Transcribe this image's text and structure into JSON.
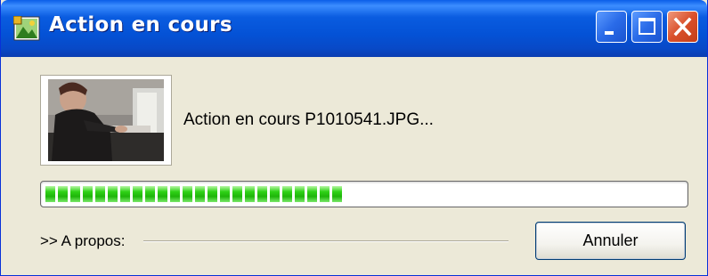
{
  "window": {
    "title": "Action en cours",
    "app_icon": "image-editor-app-icon",
    "controls": {
      "minimize": "minimize-icon",
      "maximize": "maximize-icon",
      "close": "close-icon"
    }
  },
  "content": {
    "thumbnail": "photo-thumbnail",
    "status_text": "Action en cours P1010541.JPG...",
    "progress_fraction": 0.47,
    "progress_color": "#2FD217",
    "about_label": ">> A propos:",
    "cancel_label": "Annuler"
  },
  "colors": {
    "titlebar": "#0452D6",
    "window_bg": "#ECE9D8",
    "close_button": "#D9502B"
  }
}
